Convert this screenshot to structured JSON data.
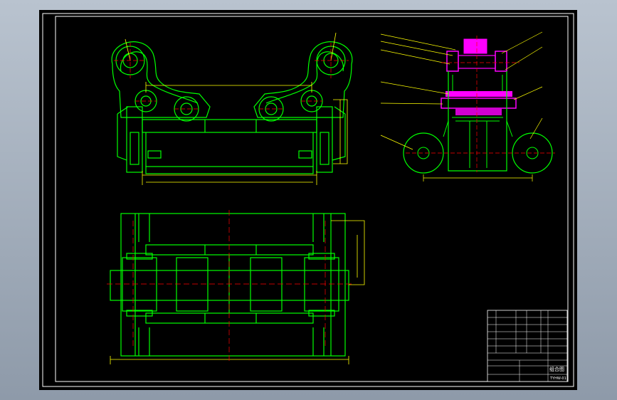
{
  "colors": {
    "app_background": "#a7b1bf",
    "sheet": "#000000",
    "frame": "#ffffff",
    "outline": "#00ff00",
    "dimension": "#ffff00",
    "centerline": "#ff0000",
    "section_fill": "#ff00ff",
    "hatch": "#d000d0"
  },
  "drawing": {
    "title_block": {
      "part_name": "组合图",
      "drawing_number": "TYHW-01"
    }
  }
}
